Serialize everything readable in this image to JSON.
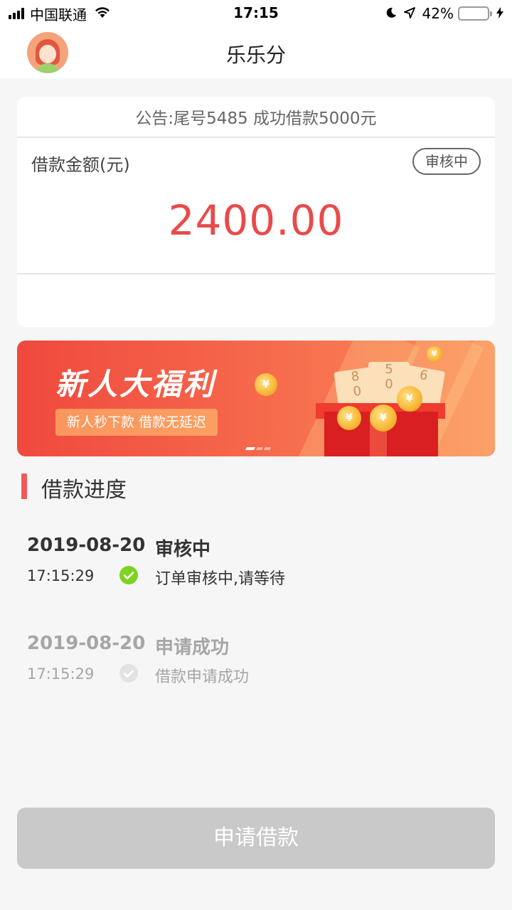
{
  "status_bar": {
    "carrier": "中国联通",
    "time": "17:15",
    "battery_percent": "42%",
    "battery_level": 0.42
  },
  "nav": {
    "title": "乐乐分",
    "avatar_icon": "user-avatar-icon"
  },
  "loan_card": {
    "notice": "公告:尾号5485 成功借款5000元",
    "amount_label": "借款金额(元)",
    "status": "审核中",
    "amount": "2400.00",
    "amount_color": "#e94a4a"
  },
  "banner": {
    "title": "新人大福利",
    "subtitle": "新人秒下款 借款无延迟",
    "pages": 3,
    "current_page": 1
  },
  "progress": {
    "title": "借款进度",
    "accent_color": "#f05a5a",
    "steps": [
      {
        "date": "2019-08-20",
        "status": "审核中",
        "time": "17:15:29",
        "desc": "订单审核中,请等待",
        "state": "active",
        "icon": "check-circle-icon"
      },
      {
        "date": "2019-08-20",
        "status": "申请成功",
        "time": "17:15:29",
        "desc": "借款申请成功",
        "state": "done",
        "icon": "check-circle-icon"
      }
    ]
  },
  "apply_button": {
    "label": "申请借款"
  }
}
